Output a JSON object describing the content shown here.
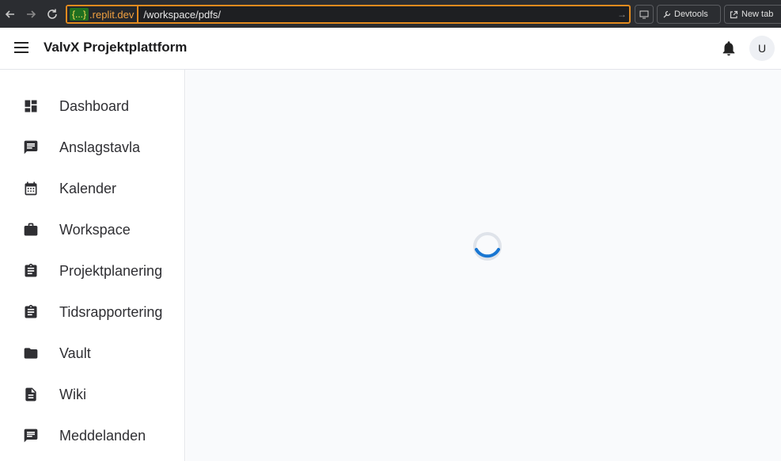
{
  "browser": {
    "url_badge": "{...}",
    "url_domain": ".replit.dev",
    "url_path": "/workspace/pdfs/",
    "devtools_label": "Devtools",
    "newtab_label": "New tab"
  },
  "header": {
    "title": "ValvX Projektplattform",
    "avatar_initial": "U"
  },
  "sidebar": {
    "items": [
      {
        "label": "Dashboard",
        "icon": "dashboard-icon"
      },
      {
        "label": "Anslagstavla",
        "icon": "chat-icon"
      },
      {
        "label": "Kalender",
        "icon": "calendar-icon"
      },
      {
        "label": "Workspace",
        "icon": "briefcase-icon"
      },
      {
        "label": "Projektplanering",
        "icon": "clipboard-icon"
      },
      {
        "label": "Tidsrapportering",
        "icon": "clipboard-icon"
      },
      {
        "label": "Vault",
        "icon": "folder-icon"
      },
      {
        "label": "Wiki",
        "icon": "document-icon"
      },
      {
        "label": "Meddelanden",
        "icon": "chat-icon"
      }
    ]
  },
  "colors": {
    "accent": "#1976d2",
    "url_highlight": "#e28a1e"
  }
}
